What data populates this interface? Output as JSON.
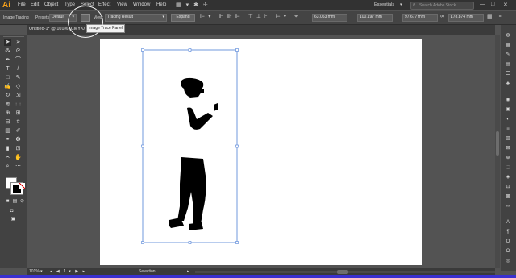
{
  "app": {
    "logo": "Ai"
  },
  "menu": [
    "File",
    "Edit",
    "Object",
    "Type",
    "Select",
    "Effect",
    "View",
    "Window",
    "Help"
  ],
  "workspace": "Essentials",
  "search_placeholder": "Search Adobe Stock",
  "control_bar": {
    "title": "Image Tracing",
    "presets_label": "Presets:",
    "preset_value": "Default",
    "view_label": "View:",
    "view_value": "Tracing Result",
    "expand_label": "Expand",
    "x_value": "63.053 mm",
    "y_value": "100.197 mm",
    "w_value": "97.677 mm",
    "h_value": "178.874 mm"
  },
  "document_tab": "Untitled-1* @ 101% (CMYK/",
  "tooltip": "Image Trace Panel",
  "status": {
    "zoom": "101%",
    "page": "1",
    "tool": "Selection"
  },
  "colors": {
    "accent": "#f7a11b",
    "bottom_bar": "#3a2fd0",
    "bounding_box": "#4d7fd6"
  }
}
